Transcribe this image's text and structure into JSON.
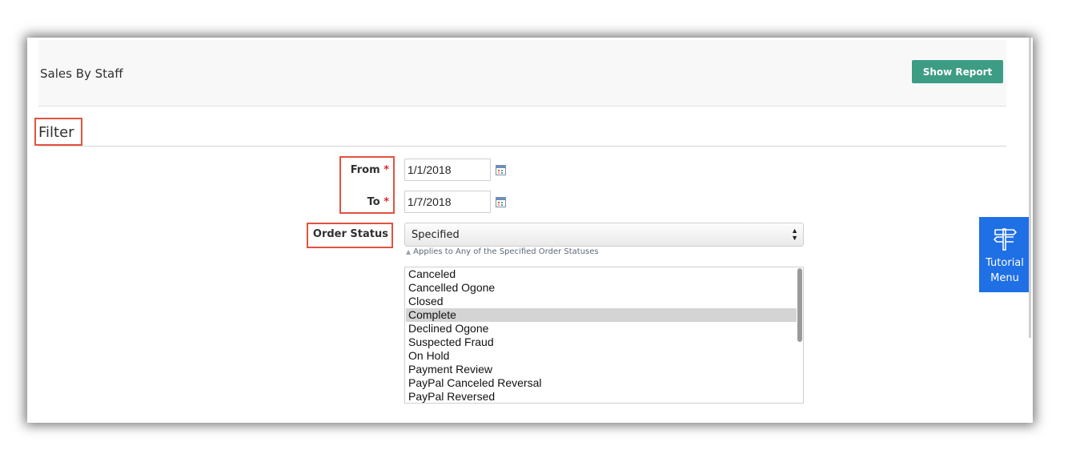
{
  "header": {
    "title": "Sales By Staff",
    "show_report_label": "Show Report"
  },
  "filter": {
    "title": "Filter",
    "from": {
      "label": "From",
      "required_mark": "*",
      "value": "1/1/2018"
    },
    "to": {
      "label": "To",
      "required_mark": "*",
      "value": "1/7/2018"
    },
    "order_status": {
      "label": "Order Status",
      "selected": "Specified",
      "hint": "Applies to Any of the Specified Order Statuses",
      "statuses": [
        {
          "label": "Canceled",
          "selected": false
        },
        {
          "label": "Cancelled Ogone",
          "selected": false
        },
        {
          "label": "Closed",
          "selected": false
        },
        {
          "label": "Complete",
          "selected": true
        },
        {
          "label": "Declined Ogone",
          "selected": false
        },
        {
          "label": "Suspected Fraud",
          "selected": false
        },
        {
          "label": "On Hold",
          "selected": false
        },
        {
          "label": "Payment Review",
          "selected": false
        },
        {
          "label": "PayPal Canceled Reversal",
          "selected": false
        },
        {
          "label": "PayPal Reversed",
          "selected": false
        }
      ]
    }
  },
  "tutorial": {
    "label_line1": "Tutorial",
    "label_line2": "Menu",
    "icon": "signpost-icon"
  },
  "colors": {
    "show_report_bg": "#3d9c84",
    "highlight_border": "#e2523f",
    "required": "#e22626",
    "tutorial_bg": "#1f6fe5",
    "selected_row_bg": "#d4d4d4"
  }
}
